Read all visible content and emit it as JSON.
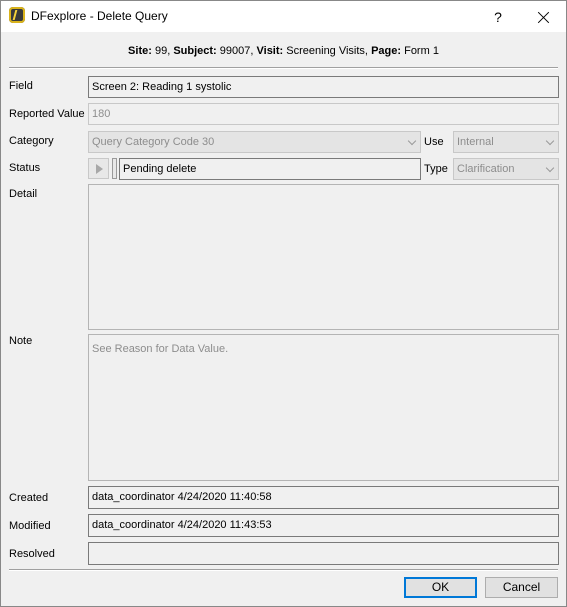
{
  "window": {
    "title": "DFexplore - Delete Query",
    "help_label": "?"
  },
  "context": {
    "site_label": "Site:",
    "site_value": "99,",
    "subject_label": "Subject:",
    "subject_value": "99007,",
    "visit_label": "Visit:",
    "visit_value": "Screening Visits,",
    "page_label": "Page:",
    "page_value": "Form 1"
  },
  "form": {
    "field_label": "Field",
    "field_value": "Screen 2: Reading 1 systolic",
    "reported_label": "Reported Value",
    "reported_value": "180",
    "category_label": "Category",
    "category_value": "Query Category Code 30",
    "use_label": "Use",
    "use_value": "Internal",
    "status_label": "Status",
    "status_value": "Pending delete",
    "type_label": "Type",
    "type_value": "Clarification",
    "detail_label": "Detail",
    "detail_value": "",
    "note_label": "Note",
    "note_value": "See Reason for Data Value.",
    "created_label": "Created",
    "created_value": "data_coordinator 4/24/2020 11:40:58",
    "modified_label": "Modified",
    "modified_value": "data_coordinator 4/24/2020 11:43:53",
    "resolved_label": "Resolved",
    "resolved_value": ""
  },
  "buttons": {
    "ok": "OK",
    "cancel": "Cancel"
  },
  "icons": {
    "app": "dfexplore-app-icon",
    "play": "play-icon",
    "close": "close-icon",
    "chevron": "chevron-down-icon"
  },
  "colors": {
    "default_button_border": "#0078d7",
    "disabled_text": "#8d8d8d"
  }
}
